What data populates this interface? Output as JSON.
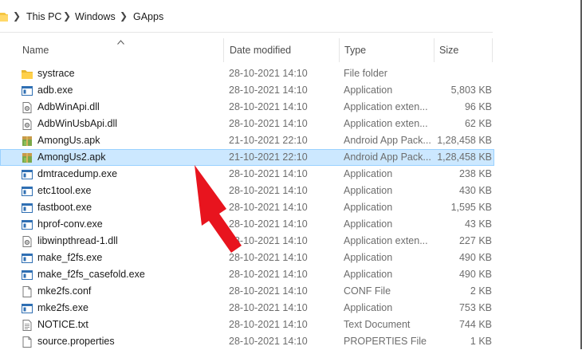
{
  "breadcrumb": {
    "items": [
      "This PC",
      "Windows",
      "GApps"
    ]
  },
  "columns": {
    "name": "Name",
    "date": "Date modified",
    "type": "Type",
    "size": "Size"
  },
  "files": [
    {
      "name": "systrace",
      "date": "28-10-2021 14:10",
      "type": "File folder",
      "size": "",
      "icon": "folder-icon"
    },
    {
      "name": "adb.exe",
      "date": "28-10-2021 14:10",
      "type": "Application",
      "size": "5,803 KB",
      "icon": "application-icon"
    },
    {
      "name": "AdbWinApi.dll",
      "date": "28-10-2021 14:10",
      "type": "Application exten...",
      "size": "96 KB",
      "icon": "dll-icon"
    },
    {
      "name": "AdbWinUsbApi.dll",
      "date": "28-10-2021 14:10",
      "type": "Application exten...",
      "size": "62 KB",
      "icon": "dll-icon"
    },
    {
      "name": "AmongUs.apk",
      "date": "21-10-2021 22:10",
      "type": "Android App Pack...",
      "size": "1,28,458 KB",
      "icon": "apk-icon"
    },
    {
      "name": "AmongUs2.apk",
      "date": "21-10-2021 22:10",
      "type": "Android App Pack...",
      "size": "1,28,458 KB",
      "icon": "apk-icon",
      "selected": true
    },
    {
      "name": "dmtracedump.exe",
      "date": "28-10-2021 14:10",
      "type": "Application",
      "size": "238 KB",
      "icon": "application-icon"
    },
    {
      "name": "etc1tool.exe",
      "date": "28-10-2021 14:10",
      "type": "Application",
      "size": "430 KB",
      "icon": "application-icon"
    },
    {
      "name": "fastboot.exe",
      "date": "28-10-2021 14:10",
      "type": "Application",
      "size": "1,595 KB",
      "icon": "application-icon"
    },
    {
      "name": "hprof-conv.exe",
      "date": "28-10-2021 14:10",
      "type": "Application",
      "size": "43 KB",
      "icon": "application-icon"
    },
    {
      "name": "libwinpthread-1.dll",
      "date": "28-10-2021 14:10",
      "type": "Application exten...",
      "size": "227 KB",
      "icon": "dll-icon"
    },
    {
      "name": "make_f2fs.exe",
      "date": "28-10-2021 14:10",
      "type": "Application",
      "size": "490 KB",
      "icon": "application-icon"
    },
    {
      "name": "make_f2fs_casefold.exe",
      "date": "28-10-2021 14:10",
      "type": "Application",
      "size": "490 KB",
      "icon": "application-icon"
    },
    {
      "name": "mke2fs.conf",
      "date": "28-10-2021 14:10",
      "type": "CONF File",
      "size": "2 KB",
      "icon": "conf-file-icon"
    },
    {
      "name": "mke2fs.exe",
      "date": "28-10-2021 14:10",
      "type": "Application",
      "size": "753 KB",
      "icon": "application-icon"
    },
    {
      "name": "NOTICE.txt",
      "date": "28-10-2021 14:10",
      "type": "Text Document",
      "size": "744 KB",
      "icon": "text-document-icon"
    },
    {
      "name": "source.properties",
      "date": "28-10-2021 14:10",
      "type": "PROPERTIES File",
      "size": "1 KB",
      "icon": "properties-file-icon"
    }
  ],
  "colors": {
    "selection": "#cce8ff",
    "selection_border": "#99d1ff",
    "annotation_arrow": "#e8141e",
    "folder": "#f5c542"
  }
}
